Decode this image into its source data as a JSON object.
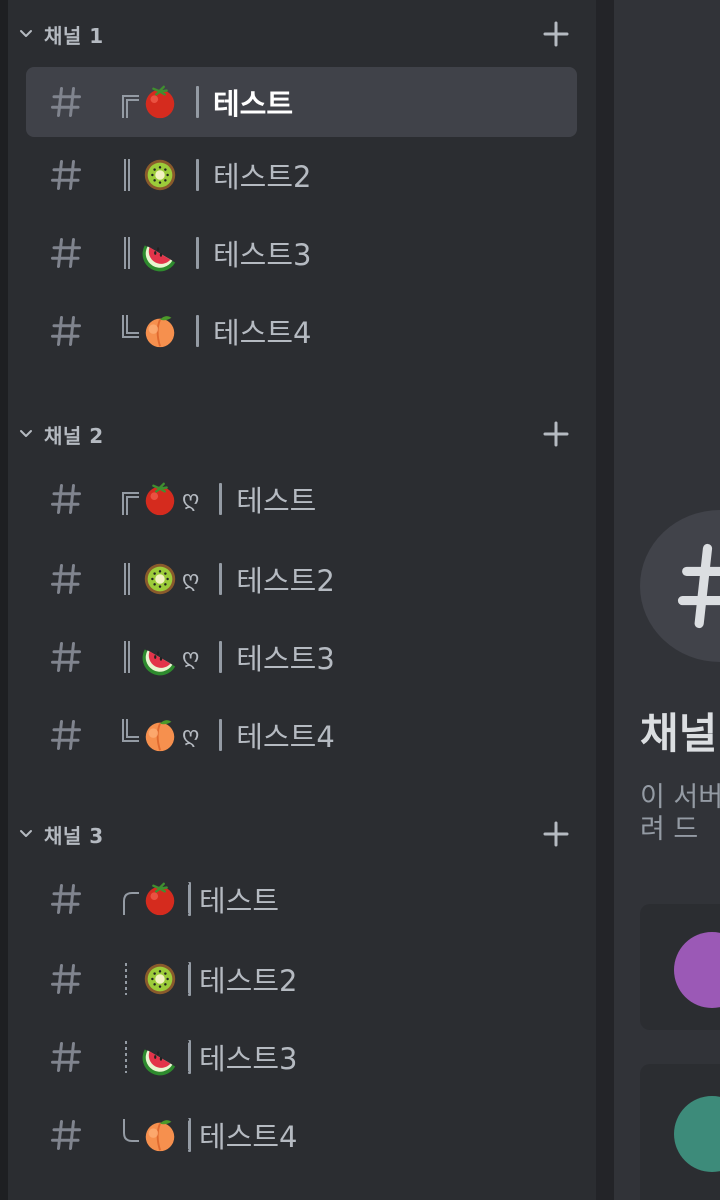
{
  "categories": [
    {
      "name": "채널 1",
      "channels": [
        {
          "tree": "┌",
          "emoji": "tomato",
          "suffix": "",
          "bar": "solid",
          "name": "테스트",
          "active": true
        },
        {
          "tree": "│",
          "emoji": "kiwi",
          "suffix": "",
          "bar": "solid",
          "name": "테스트2",
          "active": false
        },
        {
          "tree": "│",
          "emoji": "watermelon",
          "suffix": "",
          "bar": "solid",
          "name": "테스트3",
          "active": false
        },
        {
          "tree": "└",
          "emoji": "peach",
          "suffix": "",
          "bar": "solid",
          "name": "테스트4",
          "active": false
        }
      ]
    },
    {
      "name": "채널 2",
      "channels": [
        {
          "tree": "┌",
          "emoji": "tomato",
          "suffix": "ღ",
          "bar": "solid",
          "name": "테스트",
          "active": false
        },
        {
          "tree": "│",
          "emoji": "kiwi",
          "suffix": "ღ",
          "bar": "solid",
          "name": "테스트2",
          "active": false
        },
        {
          "tree": "│",
          "emoji": "watermelon",
          "suffix": "ღ",
          "bar": "solid",
          "name": "테스트3",
          "active": false
        },
        {
          "tree": "└",
          "emoji": "peach",
          "suffix": "ღ",
          "bar": "solid",
          "name": "테스트4",
          "active": false
        }
      ]
    },
    {
      "name": "채널 3",
      "channels": [
        {
          "tree": "╭",
          "emoji": "tomato",
          "suffix": "",
          "bar": "dashed",
          "name": "테스트",
          "active": false
        },
        {
          "tree": "┊",
          "emoji": "kiwi",
          "suffix": "",
          "bar": "dashed",
          "name": "테스트2",
          "active": false
        },
        {
          "tree": "┊",
          "emoji": "watermelon",
          "suffix": "",
          "bar": "dashed",
          "name": "테스트3",
          "active": false
        },
        {
          "tree": "╰",
          "emoji": "peach",
          "suffix": "",
          "bar": "dashed",
          "name": "테스트4",
          "active": false
        }
      ]
    }
  ],
  "main": {
    "welcome_title": "채널",
    "welcome_desc_line1": "이 서버",
    "welcome_desc_line2": "려 드"
  },
  "colors": {
    "sidebar_bg": "#2b2d31",
    "active_bg": "#404249",
    "text_muted": "#b5bac1",
    "text_active": "#ffffff"
  },
  "icons": {
    "category_toggle": "chevron-down-icon",
    "category_add": "plus-icon",
    "channel_type": "hash-icon"
  }
}
